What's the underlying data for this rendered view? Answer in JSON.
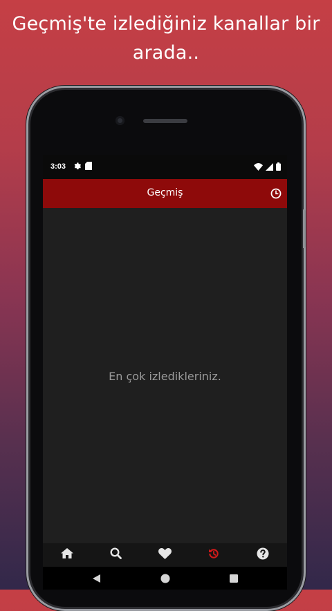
{
  "promo": {
    "line1": "Geçmiş'te izlediğiniz kanallar bir",
    "line2": "arada.."
  },
  "status_bar": {
    "time": "3:03",
    "left_icons": [
      "gear-icon",
      "sd-card-icon"
    ],
    "right_icons": [
      "wifi-icon",
      "signal-icon",
      "battery-icon"
    ]
  },
  "app_bar": {
    "title": "Geçmiş",
    "action_icon": "clock-icon"
  },
  "content": {
    "empty_message": "En çok izledikleriniz."
  },
  "bottom_nav": {
    "items": [
      {
        "icon": "home-icon",
        "active": false
      },
      {
        "icon": "search-icon",
        "active": false
      },
      {
        "icon": "heart-icon",
        "active": false
      },
      {
        "icon": "history-icon",
        "active": true
      },
      {
        "icon": "help-icon",
        "active": false
      }
    ]
  },
  "system_nav": [
    "back-button",
    "home-button",
    "recents-button"
  ],
  "colors": {
    "accent": "#8e0a0a",
    "active_icon": "#d11a1a",
    "inactive_icon": "#e6e6e6",
    "background_top": "#c53f45",
    "background_bottom": "#32284a"
  }
}
